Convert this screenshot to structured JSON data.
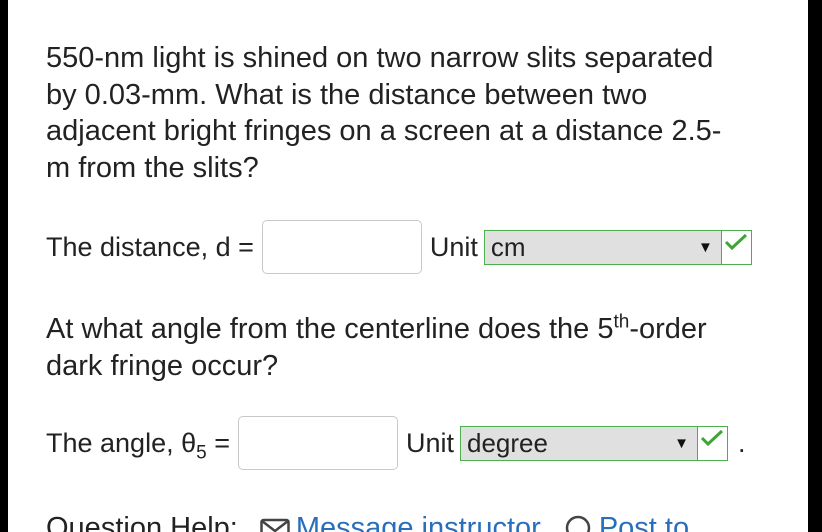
{
  "question": {
    "lines": [
      "550-nm light is shined on two narrow slits separated",
      "by 0.03-mm. What is the distance between two",
      "adjacent bright fringes on a screen at a distance 2.5-",
      "m from the slits?"
    ]
  },
  "part1": {
    "label": "The distance, d =",
    "input_value": "",
    "unit_label": "Unit",
    "unit_selected": "cm"
  },
  "part2": {
    "question_a": "At what angle from the centerline does the 5",
    "question_sup": "th",
    "question_b": "-order",
    "question_line2": "dark fringe occur?",
    "label_main": "The angle, θ",
    "label_sub": "5",
    "label_eq": " =",
    "input_value": "",
    "unit_label": "Unit",
    "unit_selected": "degree",
    "trailing": "."
  },
  "footer": {
    "question_help": "Question Help:",
    "message_instructor": "Message instructor",
    "post_to": "Post to"
  },
  "colors": {
    "check": "#3fa535",
    "select_border": "#4cae4c",
    "link": "#2a6ebb"
  },
  "icons": [
    "chevron-down-icon",
    "checkmark-icon",
    "envelope-icon",
    "chat-icon"
  ]
}
